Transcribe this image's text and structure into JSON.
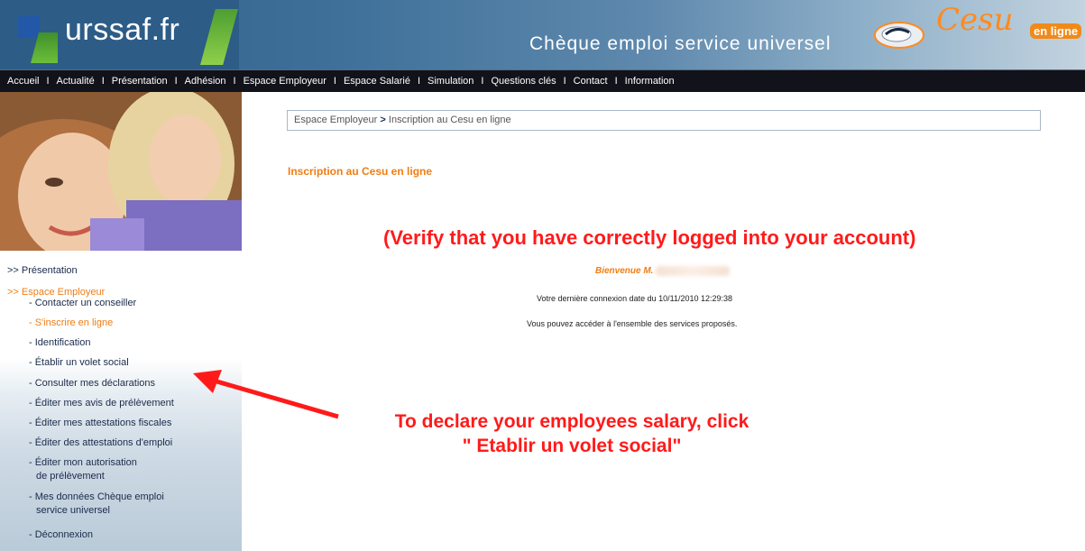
{
  "header": {
    "logo_text": "urssaf.fr",
    "title": "Chèque emploi service universel",
    "brand": "Cesu",
    "brand_sub": "en ligne",
    "colors": {
      "header_dark": "#2d5c87",
      "accent_orange": "#f07d14",
      "nav_bg": "#12121a"
    }
  },
  "nav": {
    "items": [
      "Accueil",
      "Actualité",
      "Présentation",
      "Adhésion",
      "Espace Employeur",
      "Espace Salarié",
      "Simulation",
      "Questions clés",
      "Contact",
      "Information"
    ],
    "separator": "I"
  },
  "sidebar": {
    "photo_icon": "mother-child-photo",
    "presentation": ">> Présentation",
    "espace_employeur": ">> Espace Employeur",
    "items": [
      {
        "label": "- Contacter un conseiller"
      },
      {
        "label": "- S'inscrire en ligne"
      },
      {
        "label": "- Identification"
      },
      {
        "label": "- Établir un volet social"
      },
      {
        "label": "- Consulter mes déclarations"
      },
      {
        "label": "- Éditer mes avis de prélèvement"
      },
      {
        "label": "- Éditer mes attestations fiscales"
      },
      {
        "label": "- Éditer des attestations d'emploi"
      },
      {
        "label": "- Éditer mon autorisation",
        "label2": "de prélèvement"
      },
      {
        "label": "- Mes données Chèque emploi",
        "label2": "service universel"
      },
      {
        "label": "- Déconnexion"
      }
    ]
  },
  "main": {
    "breadcrumb": {
      "part1": "Espace Employeur",
      "sep": ">",
      "part2": "Inscription au Cesu en ligne"
    },
    "page_title": "Inscription au Cesu en ligne",
    "welcome": "Bienvenue M.",
    "last_connection": "Votre dernière connexion date du 10/11/2010 12:29:38",
    "access_message": "Vous pouvez accéder à l'ensemble des services proposés."
  },
  "annotations": {
    "verify": "(Verify that you have correctly logged into your account)",
    "declare_line1": "To declare your employees salary, click",
    "declare_line2": "\" Etablir un volet social\"",
    "color": "#ff1a1a"
  }
}
